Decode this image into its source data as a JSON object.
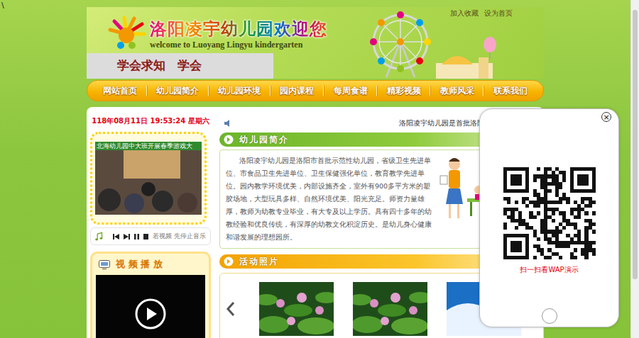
{
  "page": {
    "corner_mark": "\\"
  },
  "header": {
    "top_links": [
      "加入收藏",
      "设为首页"
    ],
    "title": "洛阳凌宇幼儿园欢迎您",
    "subtitle": "welcome to Luoyang Lingyu kindergarten",
    "motto": "学会求知　学会"
  },
  "nav": [
    {
      "label": "网站首页",
      "selected": false
    },
    {
      "label": "幼儿园简介",
      "selected": false
    },
    {
      "label": "幼儿园环境",
      "selected": false
    },
    {
      "label": "园内课程",
      "selected": false
    },
    {
      "label": "每周食谱",
      "selected": false
    },
    {
      "label": "精彩视频",
      "selected": false
    },
    {
      "label": "教师风采",
      "selected": false
    },
    {
      "label": "联系我们",
      "selected": false
    }
  ],
  "sidebar": {
    "datetime": "118年08月11日 19:53:24 星期六",
    "slide_caption": "北海幼儿园中大班开展春季游戏大",
    "music_hint": "若视频 先停止音乐",
    "video_title": "视 频 播 放"
  },
  "marquee": "洛阳凌宇幼儿园是首批洛阳市示范",
  "intro": {
    "title": "幼儿园简介",
    "text": "洛阳凌宇幼儿园是洛阳市首批示范性幼儿园，省级卫生先进单位、市食品卫生先进单位、卫生保健强化单位，教育教学先进单位。园内教学环境优美，内部设施齐全，室外有900多平方米的塑胶场地，大型玩具多样、自然环境优美、阳光充足。师资力量雄厚，教师为幼教专业毕业，有大专及以上学历。具有四十多年的幼教经验和优良传统，有深厚的幼教文化积淀历史。是幼儿身心健康和谐发展的理想园所。"
  },
  "photos": {
    "title": "活动照片",
    "items": [
      {
        "kind": "lotus"
      },
      {
        "kind": "lotus"
      },
      {
        "kind": "wave"
      }
    ]
  },
  "popup": {
    "close": "×",
    "caption": "扫一扫看WAP演示"
  }
}
